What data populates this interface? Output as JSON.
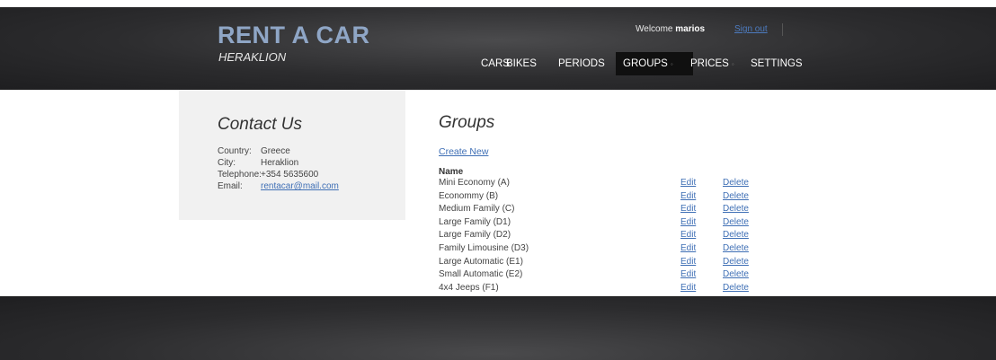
{
  "header": {
    "logo_title": "RENT A CAR",
    "logo_subtitle": "HERAKLION",
    "welcome_prefix": "Welcome ",
    "username": "marios",
    "signout": "Sign out"
  },
  "nav": {
    "items": [
      {
        "label": "CARS",
        "has_menu": false,
        "active": false
      },
      {
        "label": "BIKES",
        "has_menu": false,
        "active": false
      },
      {
        "label": "PERIODS",
        "has_menu": false,
        "active": false
      },
      {
        "label": "GROUPS",
        "has_menu": true,
        "active": true
      },
      {
        "label": "PRICES",
        "has_menu": true,
        "active": false
      },
      {
        "label": "SETTINGS",
        "has_menu": false,
        "active": false
      }
    ]
  },
  "sidebar": {
    "title": "Contact Us",
    "country_label": "Country:",
    "country": "Greece",
    "city_label": "City:",
    "city": "Heraklion",
    "phone_label": "Telephone:",
    "phone": "+354 5635600",
    "email_label": "Email:",
    "email": "rentacar@mail.com"
  },
  "main": {
    "title": "Groups",
    "create_new": "Create New",
    "column_name": "Name",
    "edit_label": "Edit",
    "delete_label": "Delete",
    "groups": [
      "Mini Economy (A)",
      "Econommy (B)",
      "Medium Family (C)",
      "Large Family (D1)",
      "Large Family (D2)",
      "Family Limousine (D3)",
      "Large Automatic (E1)",
      "Small Automatic (E2)",
      "4x4 Jeeps (F1)"
    ]
  },
  "colors": {
    "header_bg": "#2c2c2e",
    "logo_accent": "#8fa6c6",
    "link": "#3f6fb5",
    "active_nav_bg": "#101010",
    "sidebar_bg": "#f1f1f1"
  }
}
